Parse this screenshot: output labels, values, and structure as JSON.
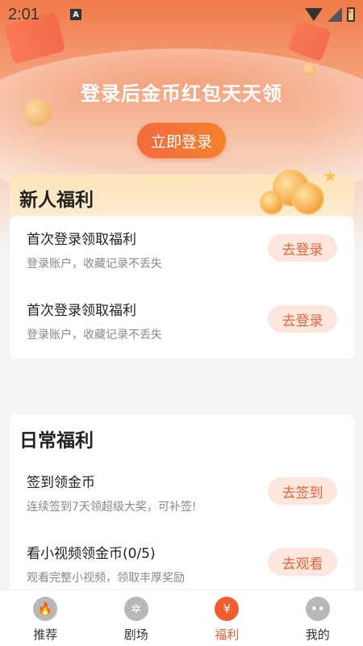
{
  "status_bar": {
    "time": "2:01",
    "notification_icon": "a-icon",
    "icons": [
      "wifi-icon",
      "signal-icon",
      "battery-charging-icon"
    ]
  },
  "hero": {
    "title": "登录后金币红包天天领",
    "login_button": "立即登录"
  },
  "sections": {
    "newbie": {
      "title": "新人福利",
      "items": [
        {
          "title": "首次登录领取福利",
          "desc": "登录账户，收藏记录不丢失",
          "button": "去登录"
        },
        {
          "title": "首次登录领取福利",
          "desc": "登录账户，收藏记录不丢失",
          "button": "去登录"
        }
      ]
    },
    "daily": {
      "title": "日常福利",
      "items": [
        {
          "title": "签到领金币",
          "desc": "连续签到7天领超级大奖，可补签!",
          "button": "去签到"
        },
        {
          "title": "看小视频领金币(0/5)",
          "desc": "观看完整小视频，领取丰厚奖励",
          "button": "去观看"
        }
      ]
    }
  },
  "bottom_nav": [
    {
      "label": "推荐",
      "icon": "flame-icon"
    },
    {
      "label": "剧场",
      "icon": "film-reel-icon"
    },
    {
      "label": "福利",
      "icon": "money-bag-icon",
      "active": true
    },
    {
      "label": "我的",
      "icon": "profile-face-icon"
    }
  ],
  "colors": {
    "accent": "#f25d2e",
    "button_bg": "#fde6de",
    "button_text": "#e8643c"
  }
}
